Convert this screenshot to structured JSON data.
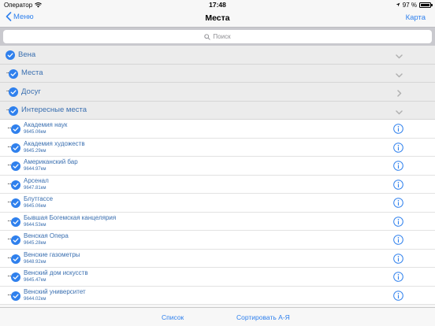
{
  "status": {
    "carrier": "Оператор",
    "time": "17:48",
    "battery": "97 %",
    "battery_level": 0.97
  },
  "nav": {
    "back_label": "Меню",
    "title": "Места",
    "right_label": "Карта"
  },
  "search": {
    "placeholder": "Поиск"
  },
  "groups": [
    {
      "label": "Вена",
      "dots": "",
      "chevron": "down"
    },
    {
      "label": "Места",
      "dots": "··",
      "chevron": "down"
    },
    {
      "label": "Досуг",
      "dots": "··",
      "chevron": "right"
    },
    {
      "label": "Интересные места",
      "dots": "··",
      "chevron": "down"
    }
  ],
  "items": [
    {
      "name": "Академия наук",
      "distance": "9645.06км"
    },
    {
      "name": "Академия художеств",
      "distance": "9645.29км"
    },
    {
      "name": "Американский бар",
      "distance": "9644.97км"
    },
    {
      "name": "Арсенал",
      "distance": "9647.81км"
    },
    {
      "name": "Блутгассе",
      "distance": "9645.06км"
    },
    {
      "name": "Бывшая Богемская  канцелярия",
      "distance": "9644.53км"
    },
    {
      "name": "Венская Опера",
      "distance": "9645.28км"
    },
    {
      "name": "Венские газометры",
      "distance": "9648.92км"
    },
    {
      "name": "Венский дом искусств",
      "distance": "9645.47км"
    },
    {
      "name": "Венский университет",
      "distance": "9644.02км"
    }
  ],
  "item_dots": "···",
  "tabs": {
    "list_label": "Список",
    "sort_label": "Сортировать А-Я"
  },
  "colors": {
    "accent": "#2f80ed",
    "check": "#2f80ed",
    "label": "#3a6fb0"
  }
}
